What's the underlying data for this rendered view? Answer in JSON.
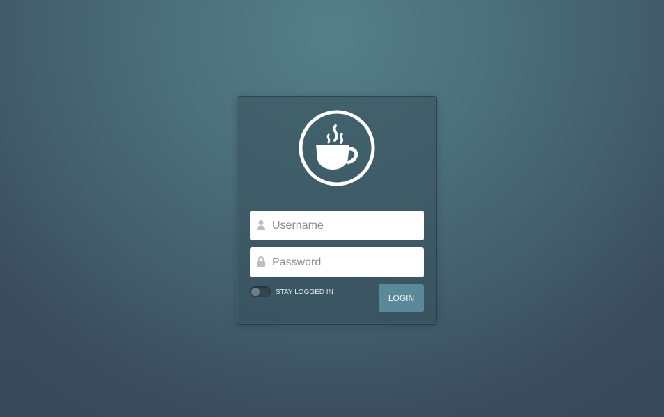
{
  "logo": {
    "icon": "coffee-cup-icon"
  },
  "form": {
    "username": {
      "icon": "user-icon",
      "placeholder": "Username",
      "value": ""
    },
    "password": {
      "icon": "lock-icon",
      "placeholder": "Password",
      "value": ""
    },
    "stay_logged_in": {
      "label": "STAY LOGGED IN",
      "checked": false
    },
    "login_label": "LOGIN"
  },
  "colors": {
    "accent_button": "#5a8a99",
    "card_bg": "#3f5e6b",
    "background": "#4c717d"
  }
}
